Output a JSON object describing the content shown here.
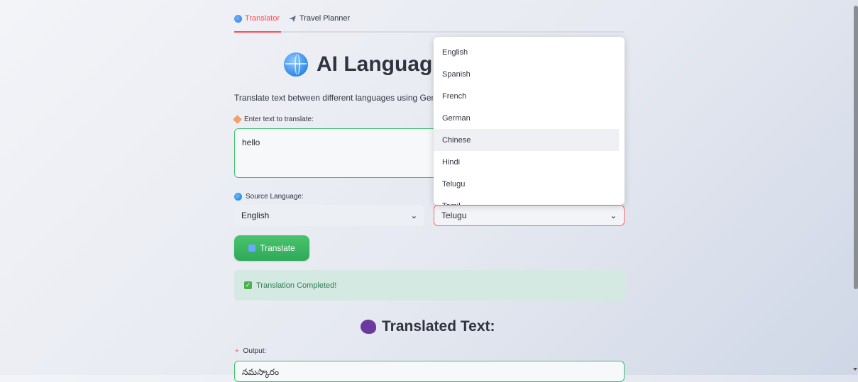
{
  "tabs": [
    {
      "label": "Translator",
      "icon": "globe-icon",
      "active": true
    },
    {
      "label": "Travel Planner",
      "icon": "airplane-icon",
      "active": false
    }
  ],
  "header": {
    "title": "AI Languag",
    "title_icon": "globe-icon"
  },
  "description": "Translate text between different languages using Gemi",
  "input": {
    "label": "Enter text to translate:",
    "value": "hello"
  },
  "source": {
    "label": "Source Language:",
    "selected": "English"
  },
  "target": {
    "selected": "Telugu"
  },
  "translate_button": {
    "label": "Translate"
  },
  "success": {
    "text": "Translation Completed!"
  },
  "translated_heading": "Translated Text:",
  "output": {
    "label": "Output:",
    "value": "నమస్కారం"
  },
  "dropdown": {
    "options": [
      "English",
      "Spanish",
      "French",
      "German",
      "Chinese",
      "Hindi",
      "Telugu",
      "Tamil"
    ],
    "highlighted": "Chinese"
  },
  "colors": {
    "accent": "#ff4b4b",
    "success_bg": "#d4e9e2",
    "button": "#3cb864",
    "border_green": "#3ec16b"
  }
}
